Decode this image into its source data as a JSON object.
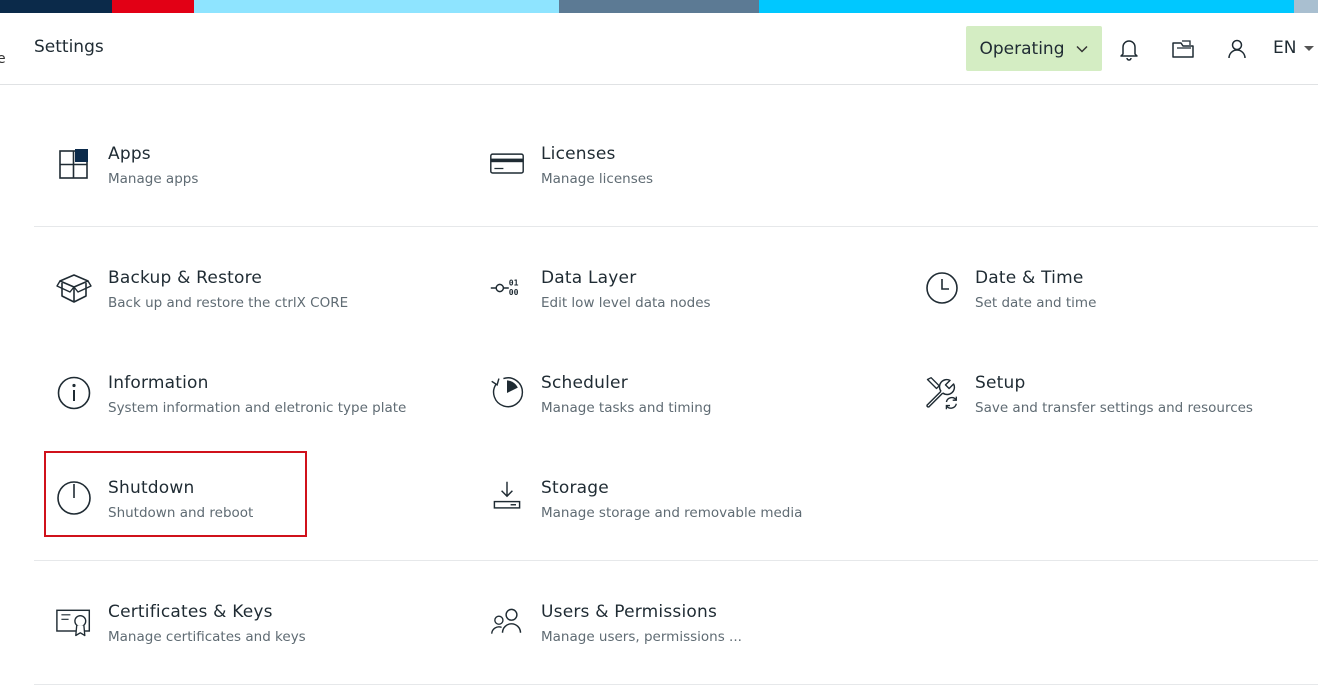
{
  "brand_stripes": [
    "#0b2a4a",
    "#e20015",
    "#8ee4ff",
    "#5c7a94",
    "#00c8ff",
    "#a9bfd0"
  ],
  "header": {
    "menu_stub": "e",
    "title": "Settings",
    "status_label": "Operating",
    "status_color": "#d4edc3",
    "language": "EN"
  },
  "highlight_color": "#d0111b",
  "tiles": {
    "apps": {
      "name": "Apps",
      "desc": "Manage apps"
    },
    "licenses": {
      "name": "Licenses",
      "desc": "Manage licenses"
    },
    "backup": {
      "name": "Backup & Restore",
      "desc": "Back up and restore the ctrlX CORE"
    },
    "datalayer": {
      "name": "Data Layer",
      "desc": "Edit low level data nodes"
    },
    "datetime": {
      "name": "Date & Time",
      "desc": "Set date and time"
    },
    "information": {
      "name": "Information",
      "desc": "System information and eletronic type plate"
    },
    "scheduler": {
      "name": "Scheduler",
      "desc": "Manage tasks and timing"
    },
    "setup": {
      "name": "Setup",
      "desc": "Save and transfer settings and resources"
    },
    "shutdown": {
      "name": "Shutdown",
      "desc": "Shutdown and reboot"
    },
    "storage": {
      "name": "Storage",
      "desc": "Manage storage and removable media"
    },
    "certificates": {
      "name": "Certificates & Keys",
      "desc": "Manage certificates and keys"
    },
    "users": {
      "name": "Users & Permissions",
      "desc": "Manage users, permissions ..."
    }
  }
}
